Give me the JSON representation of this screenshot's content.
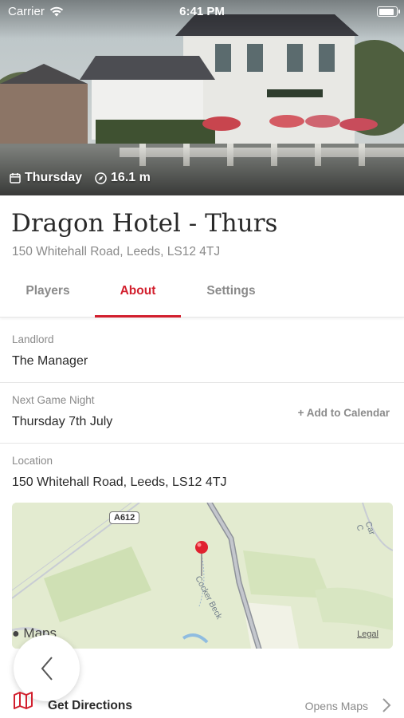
{
  "status_bar": {
    "carrier": "Carrier",
    "time": "6:41 PM",
    "battery_level": 0.9
  },
  "hero": {
    "day": "Thursday",
    "distance": "16.1 m",
    "day_icon": "calendar-icon",
    "distance_icon": "compass-icon"
  },
  "venue": {
    "name": "Dragon Hotel - Thurs",
    "address": "150 Whitehall Road, Leeds, LS12 4TJ"
  },
  "tabs": [
    {
      "label": "Players",
      "active": false
    },
    {
      "label": "About",
      "active": true
    },
    {
      "label": "Settings",
      "active": false
    }
  ],
  "about": {
    "landlord_label": "Landlord",
    "landlord_value": "The Manager",
    "next_game_label": "Next Game Night",
    "next_game_value": "Thursday 7th July",
    "add_calendar": "+ Add to Calendar",
    "location_label": "Location",
    "location_value": "150 Whitehall Road, Leeds, LS12 4TJ"
  },
  "map": {
    "road_label": "A612",
    "stream_label": "Cocker Beck",
    "road2_label": "Car C",
    "maps_label": "Maps",
    "legal": "Legal"
  },
  "directions": {
    "label": "Get Directions",
    "sub": "Opens Maps",
    "icon": "map-icon"
  },
  "colors": {
    "accent": "#d21f2d",
    "muted": "#8a8a8a"
  }
}
